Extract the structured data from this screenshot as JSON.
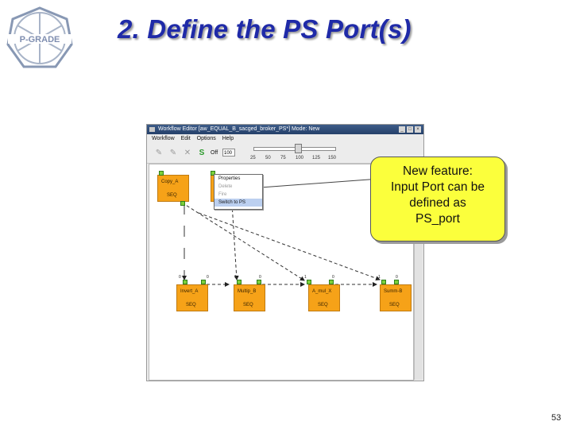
{
  "slide": {
    "title": "2. Define the PS Port(s)",
    "page_number": "53",
    "logo_text": "P-GRADE",
    "callout_lines": [
      "New feature:",
      "Input Port can be",
      "defined as",
      "PS_port"
    ]
  },
  "window": {
    "title": "Workflow Editor [aw_EQUAL_B_sacged_broker_PS*] Mode: New",
    "menu": [
      "Workflow",
      "Edit",
      "Options",
      "Help"
    ],
    "off_label": "Off",
    "zoom_value": "100",
    "slider_ticks": [
      "25",
      "50",
      "75",
      "100",
      "125",
      "150"
    ],
    "window_buttons": [
      "_",
      "□",
      "×"
    ]
  },
  "context_menu": {
    "items": [
      "Properties",
      "Delete",
      "Fire",
      "Switch to PS"
    ],
    "selected": "Switch to PS"
  },
  "jobs": [
    {
      "name": "Copy_A",
      "type": "SEQ"
    },
    {
      "name": "",
      "type": ""
    },
    {
      "name": "Invert_A",
      "type": "SEQ"
    },
    {
      "name": "Multip_B",
      "type": "SEQ"
    },
    {
      "name": "A_mul_X",
      "type": "SEQ"
    },
    {
      "name": "Summ-B",
      "type": "SEQ"
    }
  ],
  "port_labels": [
    "0",
    "0",
    "1",
    "0",
    "1",
    "0",
    "1",
    "0",
    "1",
    "0"
  ],
  "colors": {
    "title": "#1f2aa8",
    "job_fill": "#f6a218",
    "port_fill": "#7ccf3a",
    "callout_fill": "#fbff3c",
    "menu_highlight": "#bcd0f0"
  }
}
